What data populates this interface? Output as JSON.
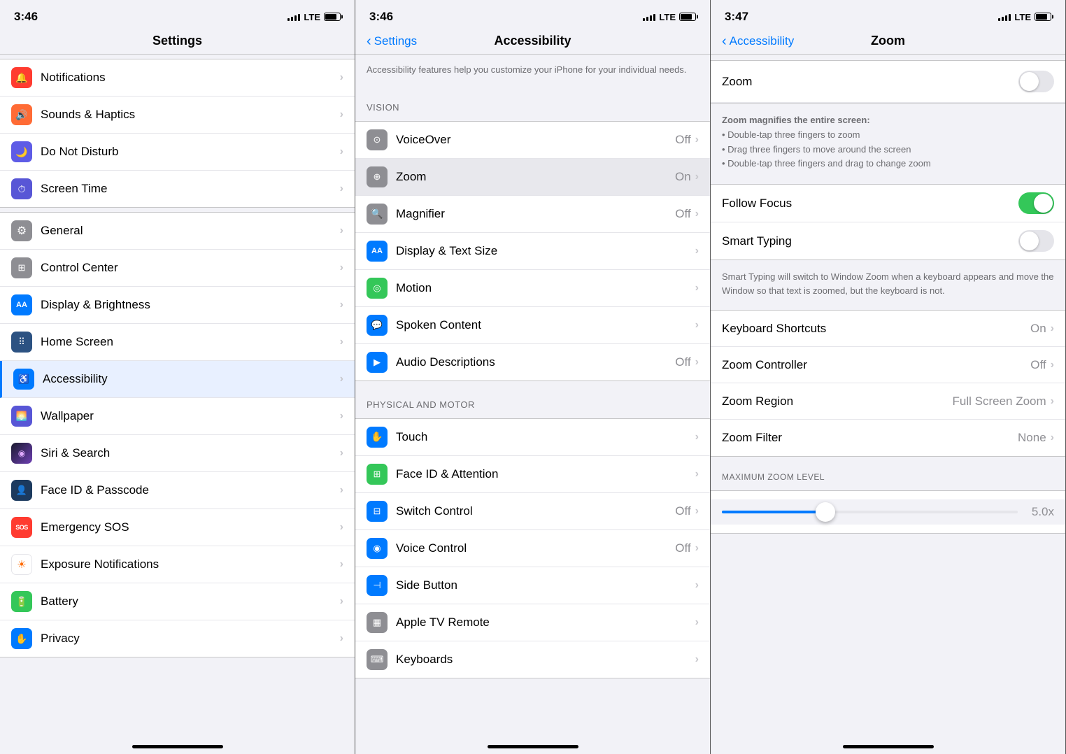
{
  "panel1": {
    "status": {
      "time": "3:46",
      "network": "LTE"
    },
    "title": "Settings",
    "items": [
      {
        "id": "notifications",
        "label": "Notifications",
        "icon_color": "icon-red",
        "icon_char": "🔔",
        "value": ""
      },
      {
        "id": "sounds",
        "label": "Sounds & Haptics",
        "icon_color": "icon-orange",
        "icon_char": "🔊",
        "value": ""
      },
      {
        "id": "donotdisturb",
        "label": "Do Not Disturb",
        "icon_color": "icon-purple-dark",
        "icon_char": "🌙",
        "value": ""
      },
      {
        "id": "screentime",
        "label": "Screen Time",
        "icon_color": "icon-purple",
        "icon_char": "⏱",
        "value": ""
      },
      {
        "id": "general",
        "label": "General",
        "icon_color": "icon-gray",
        "icon_char": "⚙",
        "value": ""
      },
      {
        "id": "controlcenter",
        "label": "Control Center",
        "icon_color": "icon-gray",
        "icon_char": "🎛",
        "value": ""
      },
      {
        "id": "display",
        "label": "Display & Brightness",
        "icon_color": "icon-blue",
        "icon_char": "AA",
        "value": ""
      },
      {
        "id": "homescreen",
        "label": "Home Screen",
        "icon_color": "icon-blue-dark",
        "icon_char": "⠿",
        "value": ""
      },
      {
        "id": "accessibility",
        "label": "Accessibility",
        "icon_color": "icon-accessibility",
        "icon_char": "♿",
        "value": "",
        "selected": true
      },
      {
        "id": "wallpaper",
        "label": "Wallpaper",
        "icon_color": "icon-wallpaper",
        "icon_char": "🖼",
        "value": ""
      },
      {
        "id": "siri",
        "label": "Siri & Search",
        "icon_color": "icon-siri",
        "icon_char": "◉",
        "value": ""
      },
      {
        "id": "faceid",
        "label": "Face ID & Passcode",
        "icon_color": "icon-faceid",
        "icon_char": "👤",
        "value": ""
      },
      {
        "id": "sos",
        "label": "Emergency SOS",
        "icon_color": "icon-sos",
        "icon_char": "SOS",
        "value": ""
      },
      {
        "id": "exposure",
        "label": "Exposure Notifications",
        "icon_color": "icon-exposure",
        "icon_char": "☀",
        "value": ""
      },
      {
        "id": "battery",
        "label": "Battery",
        "icon_color": "icon-battery",
        "icon_char": "🔋",
        "value": ""
      },
      {
        "id": "privacy",
        "label": "Privacy",
        "icon_color": "icon-privacy",
        "icon_char": "✋",
        "value": ""
      }
    ]
  },
  "panel2": {
    "status": {
      "time": "3:46",
      "network": "LTE"
    },
    "back_label": "Settings",
    "title": "Accessibility",
    "description": "Accessibility features help you customize your iPhone for your individual needs.",
    "vision_header": "VISION",
    "vision_items": [
      {
        "id": "voiceover",
        "label": "VoiceOver",
        "value": "Off",
        "icon_color": "icon-gray",
        "icon_char": "⊙"
      },
      {
        "id": "zoom",
        "label": "Zoom",
        "value": "On",
        "icon_color": "icon-gray",
        "icon_char": "⊕",
        "selected": true
      },
      {
        "id": "magnifier",
        "label": "Magnifier",
        "value": "Off",
        "icon_color": "icon-gray",
        "icon_char": "🔍"
      },
      {
        "id": "displaytext",
        "label": "Display & Text Size",
        "value": "",
        "icon_color": "icon-blue",
        "icon_char": "AA"
      },
      {
        "id": "motion",
        "label": "Motion",
        "value": "",
        "icon_color": "icon-green",
        "icon_char": "◎"
      },
      {
        "id": "spokencontent",
        "label": "Spoken Content",
        "value": "",
        "icon_color": "icon-blue",
        "icon_char": "💬"
      },
      {
        "id": "audiodesc",
        "label": "Audio Descriptions",
        "value": "Off",
        "icon_color": "icon-blue",
        "icon_char": "▶"
      }
    ],
    "motor_header": "PHYSICAL AND MOTOR",
    "motor_items": [
      {
        "id": "touch",
        "label": "Touch",
        "value": "",
        "icon_color": "icon-blue",
        "icon_char": "✋"
      },
      {
        "id": "faceid",
        "label": "Face ID & Attention",
        "value": "",
        "icon_color": "icon-green",
        "icon_char": "⊞"
      },
      {
        "id": "switchcontrol",
        "label": "Switch Control",
        "value": "Off",
        "icon_color": "icon-blue",
        "icon_char": "⊟"
      },
      {
        "id": "voicecontrol",
        "label": "Voice Control",
        "value": "Off",
        "icon_color": "icon-blue",
        "icon_char": "◉"
      },
      {
        "id": "sidebutton",
        "label": "Side Button",
        "value": "",
        "icon_color": "icon-blue",
        "icon_char": "⊣"
      },
      {
        "id": "appletvremote",
        "label": "Apple TV Remote",
        "value": "",
        "icon_color": "icon-gray",
        "icon_char": "▦"
      },
      {
        "id": "keyboards",
        "label": "Keyboards",
        "value": "",
        "icon_color": "icon-gray",
        "icon_char": "⌨"
      }
    ]
  },
  "panel3": {
    "status": {
      "time": "3:47",
      "network": "LTE"
    },
    "back_label": "Accessibility",
    "title": "Zoom",
    "zoom_toggle": {
      "label": "Zoom",
      "state": "off"
    },
    "zoom_description": {
      "title": "Zoom magnifies the entire screen:",
      "bullets": [
        "Double-tap three fingers to zoom",
        "Drag three fingers to move around the screen",
        "Double-tap three fingers and drag to change zoom"
      ]
    },
    "settings_items": [
      {
        "id": "follow_focus",
        "label": "Follow Focus",
        "type": "toggle",
        "state": "on"
      },
      {
        "id": "smart_typing",
        "label": "Smart Typing",
        "type": "toggle",
        "state": "off"
      }
    ],
    "smart_typing_note": "Smart Typing will switch to Window Zoom when a keyboard appears and move the Window so that text is zoomed, but the keyboard is not.",
    "detail_items": [
      {
        "id": "keyboard_shortcuts",
        "label": "Keyboard Shortcuts",
        "value": "On"
      },
      {
        "id": "zoom_controller",
        "label": "Zoom Controller",
        "value": "Off"
      },
      {
        "id": "zoom_region",
        "label": "Zoom Region",
        "value": "Full Screen Zoom"
      },
      {
        "id": "zoom_filter",
        "label": "Zoom Filter",
        "value": "None"
      }
    ],
    "max_zoom_header": "MAXIMUM ZOOM LEVEL",
    "max_zoom_value": "5.0x"
  }
}
